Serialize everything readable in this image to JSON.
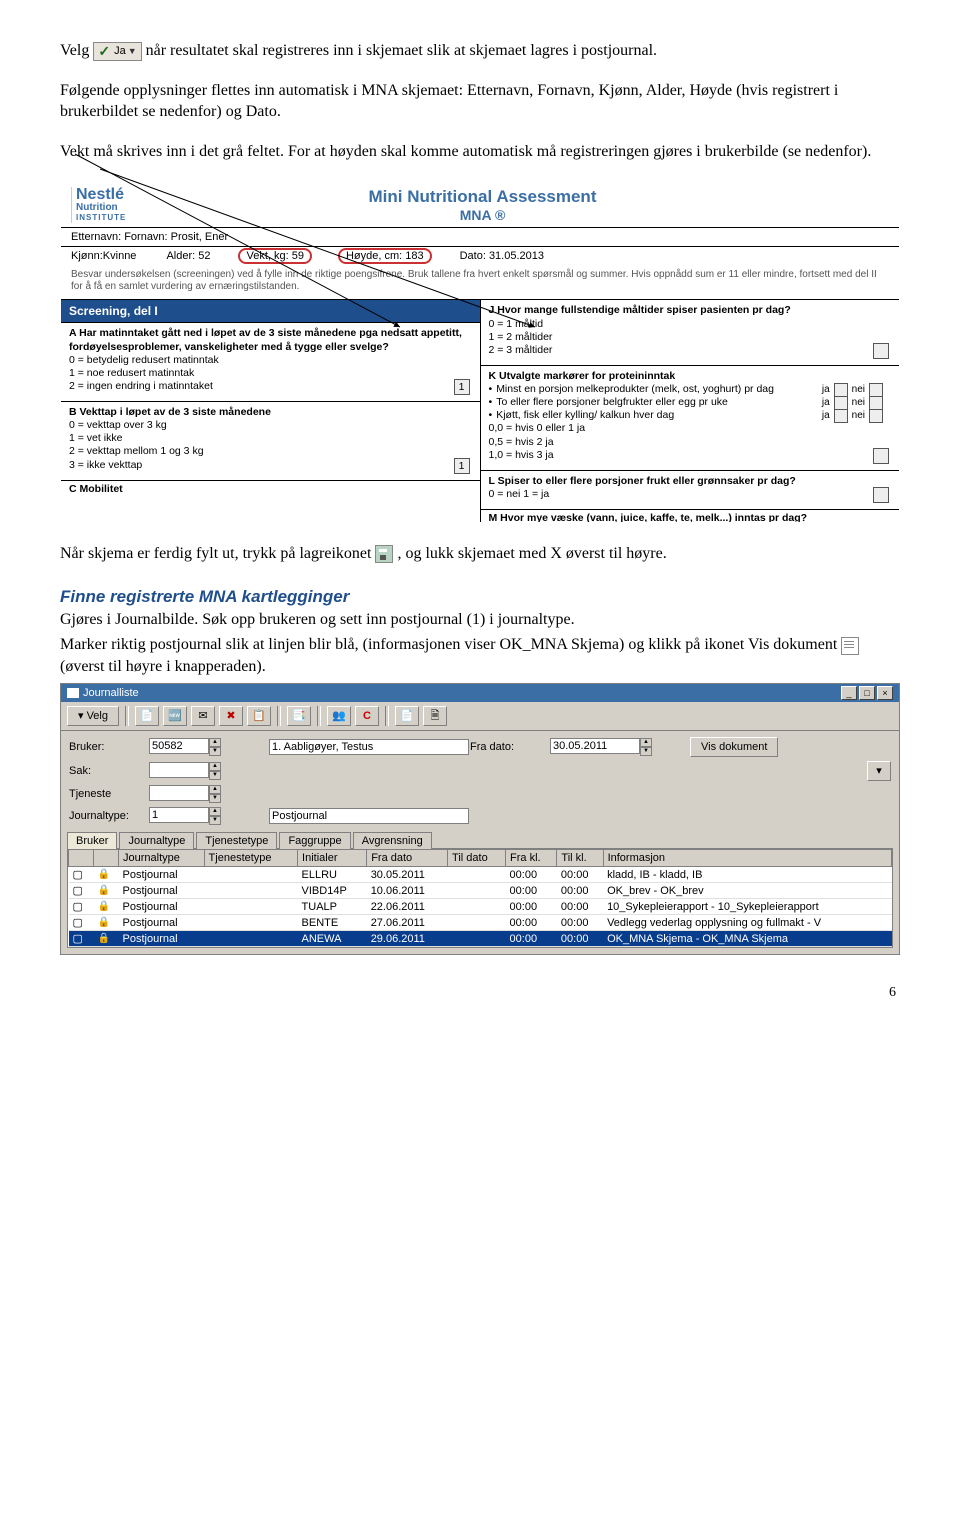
{
  "intro": {
    "velg": "Velg",
    "ja_button": "Ja",
    "p1_rest": " når resultatet skal registreres inn i skjemaet slik at skjemaet lagres i postjournal.",
    "p2": "Følgende opplysninger flettes inn automatisk i MNA skjemaet: Etternavn, Fornavn, Kjønn, Alder, Høyde (hvis registrert i brukerbildet se nedenfor) og Dato.",
    "p3": "Vekt må skrives inn i det grå feltet. For at høyden skal komme automatisk må registreringen gjøres i brukerbilde (se nedenfor)."
  },
  "mna": {
    "logo_top": "Nestlé",
    "logo_mid": "Nutrition",
    "logo_bot": "INSTITUTE",
    "title": "Mini Nutritional Assessment",
    "title_sub": "MNA ®",
    "name_row": "Etternavn: Fornavn: Prosit, Ener",
    "info": {
      "kjonn": "Kjønn:Kvinne",
      "alder": "Alder: 52",
      "vekt": "Vekt, kg: 59",
      "hoyde": "Høyde, cm: 183",
      "dato": "Dato: 31.05.2013"
    },
    "desc": "Besvar undersøkelsen (screeningen) ved å fylle inn de riktige poengsifrene. Bruk tallene fra hvert enkelt spørsmål og summer. Hvis oppnådd sum er 11 eller mindre, fortsett med del II for å få en samlet vurdering av ernæringstilstanden.",
    "screening_label": "Screening, del I",
    "qA": {
      "head": "A Har matinntaket gått ned i løpet av de 3 siste månedene pga nedsatt appetitt, fordøyelsesproblemer, vanskeligheter med å tygge eller svelge?",
      "o0": "0 = betydelig redusert matinntak",
      "o1": "1 = noe redusert matinntak",
      "o2": "2 = ingen endring i matinntaket",
      "val": "1"
    },
    "qB": {
      "head": "B Vekttap i løpet av de 3 siste månedene",
      "o0": "0 = vekttap over 3 kg",
      "o1": "1 = vet ikke",
      "o2": "2 = vekttap mellom 1 og 3 kg",
      "o3": "3 = ikke vekttap",
      "val": "1"
    },
    "qC": "C Mobilitet",
    "qJ": {
      "head": "J Hvor mange fullstendige måltider spiser pasienten pr dag?",
      "o0": "0 = 1 måltid",
      "o1": "1 = 2 måltider",
      "o2": "2 = 3 måltider"
    },
    "qK": {
      "head": "K Utvalgte markører for proteininntak",
      "b1": "Minst en porsjon melkeprodukter (melk, ost, yoghurt) pr dag",
      "b2": "To eller flere porsjoner belgfrukter eller egg pr uke",
      "b3": "Kjøtt, fisk eller kylling/ kalkun hver dag",
      "s0": "0,0   = hvis 0 eller 1 ja",
      "s1": "0,5   = hvis 2 ja",
      "s2": "1,0   = hvis 3 ja",
      "ja": "ja",
      "nei": "nei"
    },
    "qL": {
      "head": "L Spiser to eller flere porsjoner frukt eller grønnsaker pr dag?",
      "o": "0 = nei    1 = ja"
    },
    "qM": "M Hvor mye væske (vann, juice, kaffe, te, melk...) inntas pr dag?"
  },
  "after": {
    "p1a": "Når skjema er ferdig fylt ut, trykk på lagreikonet ",
    "p1b": ", og lukk skjemaet med X øverst til høyre.",
    "h_finne": "Finne registrerte MNA kartlegginger",
    "p2": "Gjøres i Journalbilde. Søk opp brukeren og sett inn postjournal (1) i journaltype.",
    "p3a": "Marker riktig postjournal slik at linjen blir blå, (informasjonen viser OK_MNA Skjema) og klikk på ikonet Vis dokument ",
    "p3b": " (øverst til høyre i knapperaden)."
  },
  "jl": {
    "title": "Journalliste",
    "velg": "Velg",
    "form": {
      "bruker_lbl": "Bruker:",
      "bruker_val": "50582",
      "bruker_name": "1. Aabligøyer, Testus",
      "fradato_lbl": "Fra dato:",
      "fradato_val": "30.05.2011",
      "visdok": "Vis dokument",
      "sak_lbl": "Sak:",
      "tjeneste_lbl": "Tjeneste",
      "jtype_lbl": "Journaltype:",
      "jtype_num": "1",
      "jtype_name": "Postjournal"
    },
    "tabs": [
      "Bruker",
      "Journaltype",
      "Tjenestetype",
      "Faggruppe",
      "Avgrensning"
    ],
    "headers": [
      "",
      "",
      "Journaltype",
      "Tjenestetype",
      "Initialer",
      "Fra dato",
      "Til dato",
      "Fra kl.",
      "Til kl.",
      "Informasjon"
    ],
    "rows": [
      {
        "jt": "Postjournal",
        "init": "ELLRU",
        "fra": "30.05.2011",
        "frakl": "00:00",
        "tilkl": "00:00",
        "info": "kladd, IB - kladd, IB"
      },
      {
        "jt": "Postjournal",
        "init": "VIBD14P",
        "fra": "10.06.2011",
        "frakl": "00:00",
        "tilkl": "00:00",
        "info": "OK_brev - OK_brev"
      },
      {
        "jt": "Postjournal",
        "init": "TUALP",
        "fra": "22.06.2011",
        "frakl": "00:00",
        "tilkl": "00:00",
        "info": "10_Sykepleierapport - 10_Sykepleierapport"
      },
      {
        "jt": "Postjournal",
        "init": "BENTE",
        "fra": "27.06.2011",
        "frakl": "00:00",
        "tilkl": "00:00",
        "info": "Vedlegg vederlag opplysning og fullmakt - V"
      },
      {
        "jt": "Postjournal",
        "init": "ANEWA",
        "fra": "29.06.2011",
        "frakl": "00:00",
        "tilkl": "00:00",
        "info": "OK_MNA Skjema - OK_MNA Skjema"
      }
    ]
  },
  "page_number": "6"
}
